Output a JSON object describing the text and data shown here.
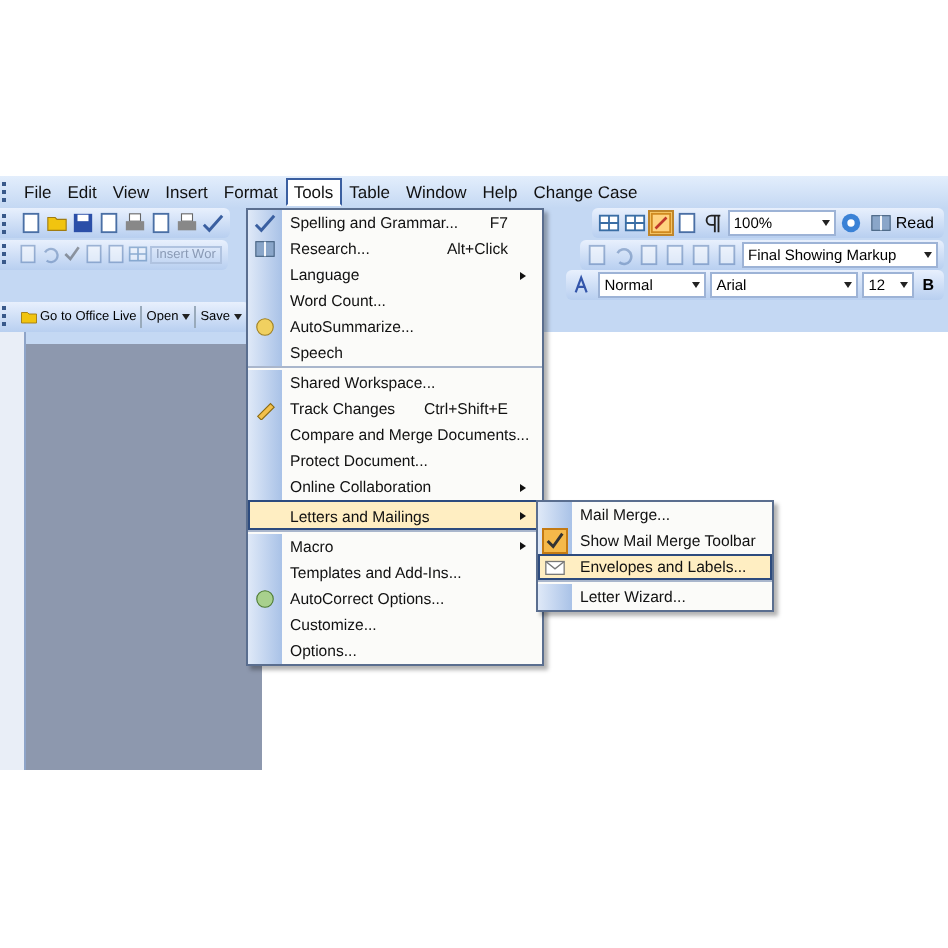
{
  "menu_bar": [
    {
      "label": "File",
      "selected": false
    },
    {
      "label": "Edit",
      "selected": false
    },
    {
      "label": "View",
      "selected": false
    },
    {
      "label": "Insert",
      "selected": false
    },
    {
      "label": "Format",
      "selected": false
    },
    {
      "label": "Tools",
      "selected": true
    },
    {
      "label": "Table",
      "selected": false
    },
    {
      "label": "Window",
      "selected": false
    },
    {
      "label": "Help",
      "selected": false
    },
    {
      "label": "Change Case",
      "selected": false
    }
  ],
  "toolbars": {
    "zoom": "100%",
    "read_button": "Read",
    "insert_button": "Insert Wor",
    "markup": "Final Showing Markup",
    "style": "Normal",
    "font": "Arial",
    "size": "12",
    "bold_button": "B"
  },
  "office_live_bar": {
    "go_button": "Go to Office Live",
    "open_button": "Open",
    "save_button": "Save"
  },
  "tools_menu": [
    {
      "label": "Spelling and Grammar...",
      "shortcut": "F7",
      "submenu": false,
      "highlighted": false,
      "separator_before": false
    },
    {
      "label": "Research...",
      "shortcut": "Alt+Click",
      "submenu": false,
      "highlighted": false,
      "separator_before": false
    },
    {
      "label": "Language",
      "submenu": true,
      "highlighted": false,
      "separator_before": false
    },
    {
      "label": "Word Count...",
      "submenu": false,
      "highlighted": false,
      "separator_before": false
    },
    {
      "label": "AutoSummarize...",
      "submenu": false,
      "highlighted": false,
      "separator_before": false
    },
    {
      "label": "Speech",
      "submenu": false,
      "highlighted": false,
      "separator_before": false
    },
    {
      "label": "Shared Workspace...",
      "submenu": false,
      "highlighted": false,
      "separator_before": true
    },
    {
      "label": "Track Changes",
      "shortcut": "Ctrl+Shift+E",
      "submenu": false,
      "highlighted": false,
      "separator_before": false
    },
    {
      "label": "Compare and Merge Documents...",
      "submenu": false,
      "highlighted": false,
      "separator_before": false
    },
    {
      "label": "Protect Document...",
      "submenu": false,
      "highlighted": false,
      "separator_before": false
    },
    {
      "label": "Online Collaboration",
      "submenu": true,
      "highlighted": false,
      "separator_before": false
    },
    {
      "label": "Letters and Mailings",
      "submenu": true,
      "highlighted": true,
      "separator_before": true
    },
    {
      "label": "Macro",
      "submenu": true,
      "highlighted": false,
      "separator_before": true
    },
    {
      "label": "Templates and Add-Ins...",
      "submenu": false,
      "highlighted": false,
      "separator_before": false
    },
    {
      "label": "AutoCorrect Options...",
      "submenu": false,
      "highlighted": false,
      "separator_before": false
    },
    {
      "label": "Customize...",
      "submenu": false,
      "highlighted": false,
      "separator_before": false
    },
    {
      "label": "Options...",
      "submenu": false,
      "highlighted": false,
      "separator_before": false
    }
  ],
  "mailings_submenu": [
    {
      "label": "Mail Merge...",
      "checked": false,
      "highlighted": false,
      "separator_before": false
    },
    {
      "label": "Show Mail Merge Toolbar",
      "checked": true,
      "highlighted": false,
      "separator_before": false
    },
    {
      "label": "Envelopes and Labels...",
      "checked": false,
      "highlighted": true,
      "separator_before": false
    },
    {
      "label": "Letter Wizard...",
      "checked": false,
      "highlighted": false,
      "separator_before": true
    }
  ]
}
